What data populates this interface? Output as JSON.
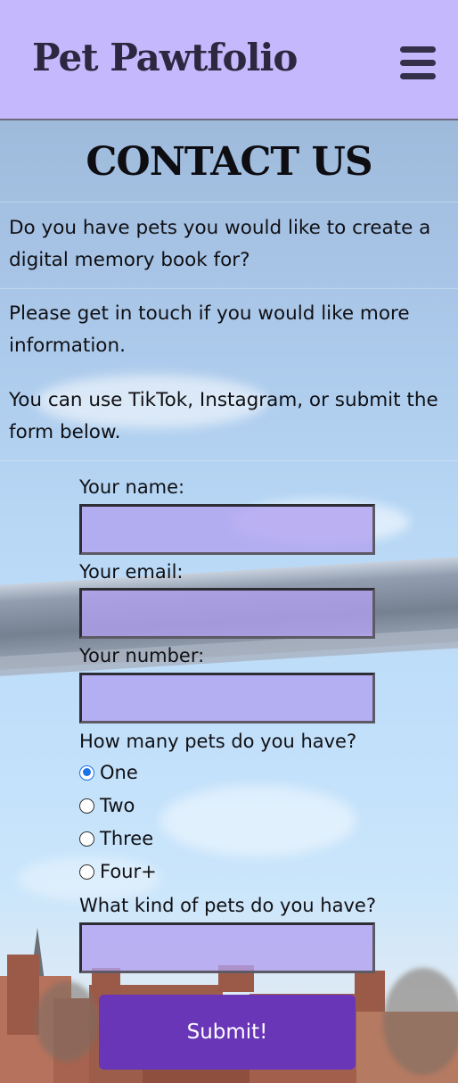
{
  "header": {
    "brand": "Pet Pawtfolio",
    "menu_icon": "hamburger-menu-icon"
  },
  "main": {
    "title": "CONTACT US",
    "paragraphs": [
      "Do you have pets you would like to create a digital memory book for?",
      "Please get in touch if you would like more information.",
      "You can use TikTok, Instagram, or submit the form below."
    ]
  },
  "form": {
    "name_label": "Your name:",
    "name_value": "",
    "email_label": "Your email:",
    "email_value": "",
    "number_label": "Your number:",
    "number_value": "",
    "pets_count_label": "How many pets do you have?",
    "pets_count_options": [
      "One",
      "Two",
      "Three",
      "Four+"
    ],
    "pets_count_selected": "One",
    "pet_kind_label": "What kind of pets do you have?",
    "pet_kind_value": "",
    "submit_label": "Submit!"
  },
  "colors": {
    "header_bg": "#c5b8fc",
    "input_bg": "#b1a0f0",
    "button_bg": "#6936b8",
    "radio_checked": "#1a73e8"
  }
}
